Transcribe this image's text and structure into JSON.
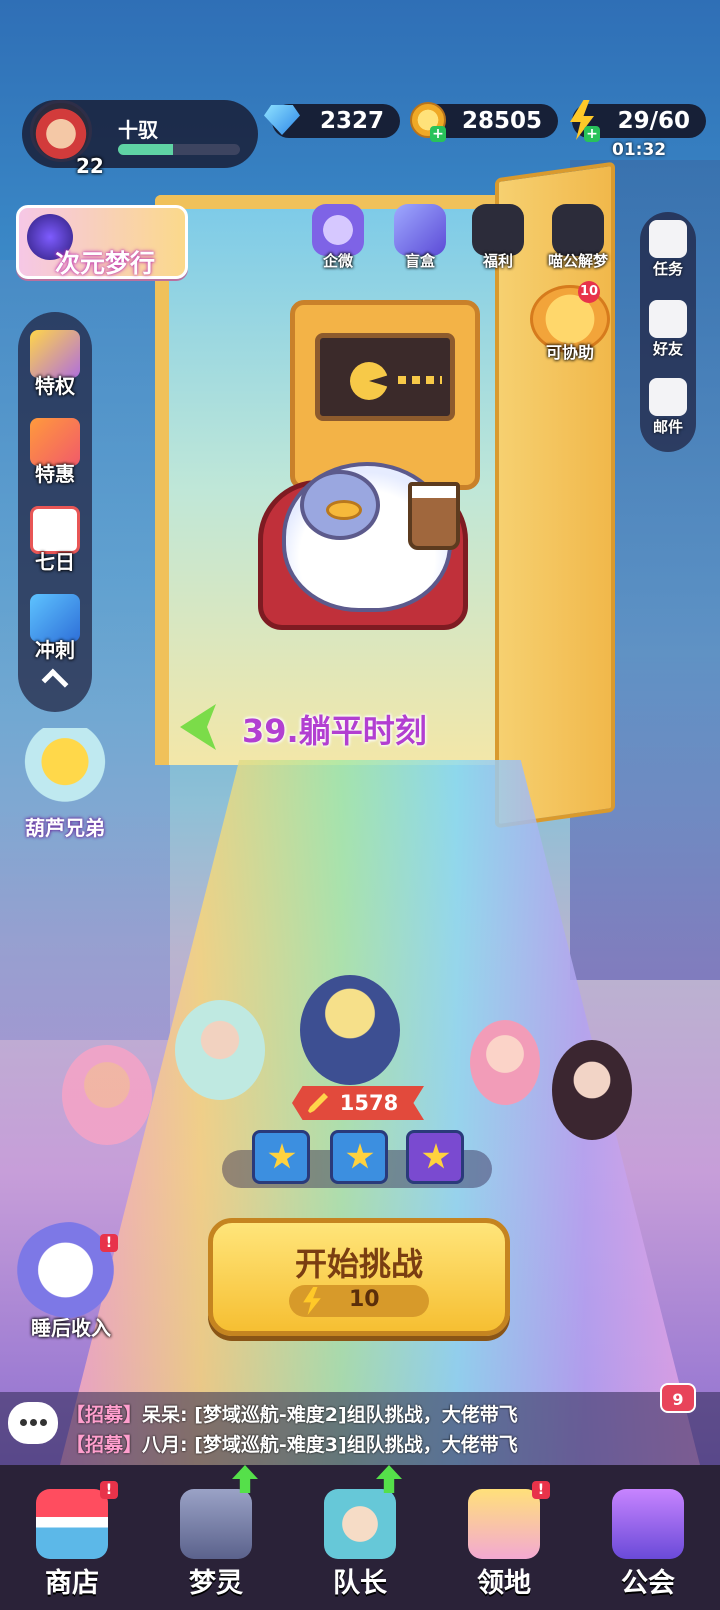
{
  "player": {
    "name": "十驭",
    "level": "22",
    "exp_progress": 0.45
  },
  "resources": {
    "gems": "2327",
    "coins": "28505",
    "energy": "29/60",
    "energy_timer": "01:32"
  },
  "event_banner": {
    "label": "次元梦行"
  },
  "top_icons": [
    {
      "label": "企微"
    },
    {
      "label": "盲盒"
    },
    {
      "label": "福利"
    },
    {
      "label": "喵公解梦"
    }
  ],
  "right_rail": [
    {
      "label": "任务"
    },
    {
      "label": "好友"
    },
    {
      "label": "邮件"
    }
  ],
  "help": {
    "label": "可协助",
    "badge": "10"
  },
  "left_rail": [
    {
      "label": "特权"
    },
    {
      "label": "特惠"
    },
    {
      "label": "七日"
    },
    {
      "label": "冲刺"
    }
  ],
  "hulu": {
    "label": "葫芦兄弟"
  },
  "stage": {
    "title": "39.躺平时刻"
  },
  "team": {
    "power": "1578"
  },
  "sleep": {
    "label": "睡后收入",
    "badge": "!"
  },
  "start": {
    "label": "开始挑战",
    "cost": "10"
  },
  "chat": {
    "unread": "9",
    "lines": [
      {
        "tag": "【招募】",
        "text": "呆呆: [梦域巡航-难度2]组队挑战，大佬带飞"
      },
      {
        "tag": "【招募】",
        "text": "八月: [梦域巡航-难度3]组队挑战，大佬带飞"
      }
    ]
  },
  "bottom_nav": [
    {
      "label": "商店",
      "badge": "!"
    },
    {
      "label": "梦灵"
    },
    {
      "label": "队长"
    },
    {
      "label": "领地",
      "badge": "!"
    },
    {
      "label": "公会"
    }
  ]
}
